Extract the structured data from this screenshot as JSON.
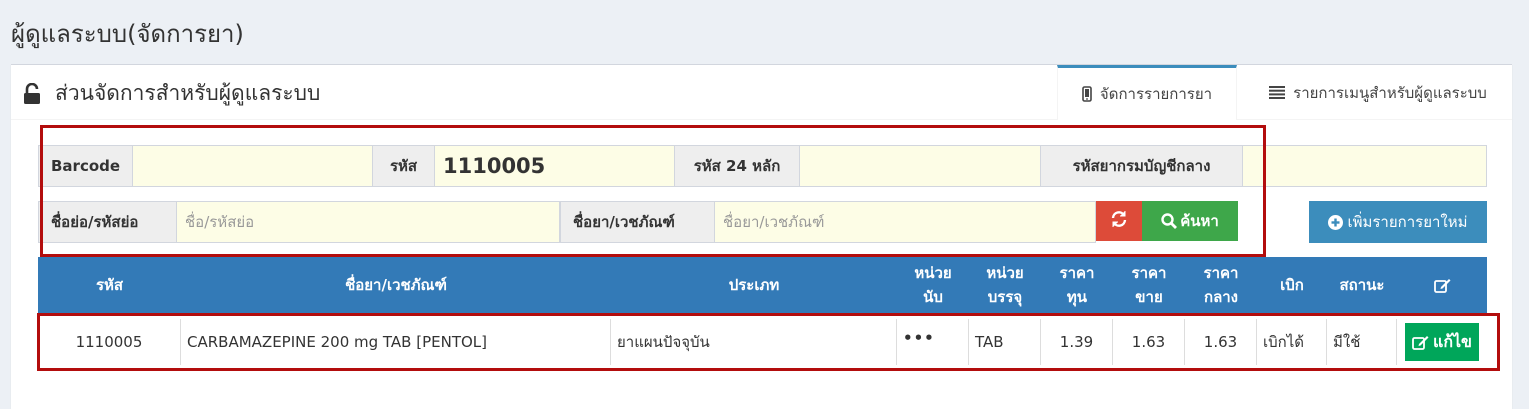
{
  "page_title": "ผู้ดูแลระบบ(จัดการยา)",
  "box": {
    "title": "ส่วนจัดการสำหรับผู้ดูแลระบบ",
    "title_icon": "unlock-icon"
  },
  "tabs": [
    {
      "label": "จัดการรายการยา",
      "icon": "mobile-icon",
      "active": true
    },
    {
      "label": "รายการเมนูสำหรับผู้ดูแลระบบ",
      "icon": "list-icon",
      "active": false
    }
  ],
  "search_form": {
    "barcode_label": "Barcode",
    "barcode_value": "",
    "code_label": "รหัส",
    "code_value": "1110005",
    "code24_label": "รหัส 24 หลัก",
    "code24_value": "",
    "central_code_label": "รหัสยากรมบัญชีกลาง",
    "central_code_value": "",
    "short_name_label": "ชื่อย่อ/รหัสย่อ",
    "short_name_placeholder": "ชื่อ/รหัสย่อ",
    "drug_name_label": "ชื่อยา/เวชภัณฑ์",
    "drug_name_placeholder": "ชื่อยา/เวชภัณฑ์",
    "refresh_icon": "refresh-icon",
    "search_button": "ค้นหา",
    "search_icon": "search-icon",
    "add_button": "เพิ่มรายการยาใหม่",
    "add_icon": "plus-circle-icon"
  },
  "table": {
    "headers": {
      "code": "รหัส",
      "name": "ชื่อยา/เวชภัณฑ์",
      "type": "ประเภท",
      "count_unit_1": "หน่วย",
      "count_unit_2": "นับ",
      "pack_unit_1": "หน่วย",
      "pack_unit_2": "บรรจุ",
      "cost_1": "ราคา",
      "cost_2": "ทุน",
      "sell_1": "ราคา",
      "sell_2": "ขาย",
      "mid_1": "ราคา",
      "mid_2": "กลาง",
      "withdraw": "เบิก",
      "status": "สถานะ",
      "edit_icon": "edit-icon"
    },
    "rows": [
      {
        "code": "1110005",
        "name": "CARBAMAZEPINE 200 mg TAB [PENTOL]",
        "type": "ยาแผนปัจจุบัน",
        "count_unit": "•••",
        "pack_unit": "TAB",
        "cost": "1.39",
        "sell": "1.63",
        "mid": "1.63",
        "withdraw": "เบิกได้",
        "status": "มีใช้",
        "edit_label": "แก้ไข"
      }
    ]
  },
  "colors": {
    "header_blue": "#337ab7",
    "highlight_red": "#b30d0d",
    "field_yellow": "#fdfde6",
    "btn_green": "#3ea74a",
    "btn_red": "#dd4b39",
    "btn_blue": "#3c8dbc"
  }
}
